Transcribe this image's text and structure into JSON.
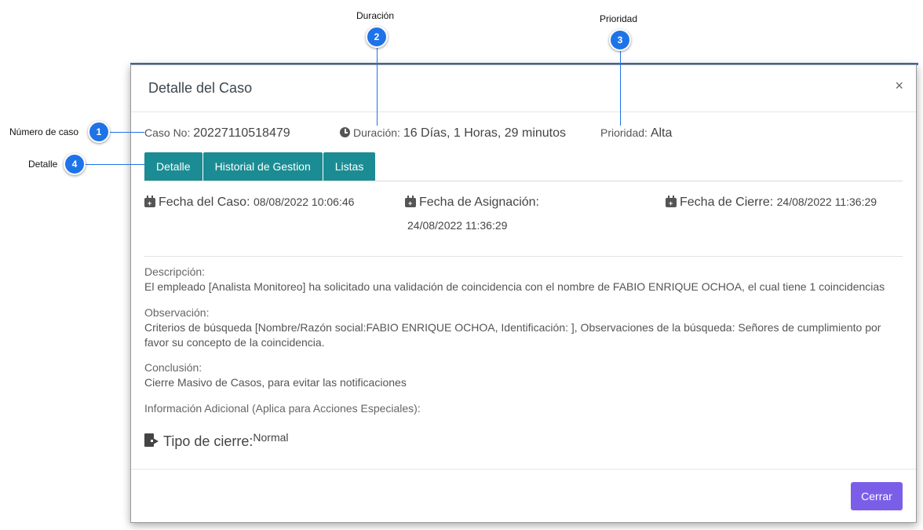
{
  "modal": {
    "title": "Detalle del Caso",
    "close": "×"
  },
  "case": {
    "number_label": "Caso No:",
    "number": "20227110518479",
    "duration_label": "Duración:",
    "duration": "16 Días, 1 Horas, 29 minutos",
    "priority_label": "Prioridad:",
    "priority": "Alta"
  },
  "tabs": [
    {
      "label": "Detalle"
    },
    {
      "label": "Historial de Gestion"
    },
    {
      "label": "Listas"
    }
  ],
  "dates": {
    "case_label": "Fecha del Caso:",
    "case_value": "08/08/2022 10:06:46",
    "assign_label": "Fecha de Asignación:",
    "assign_value": "24/08/2022 11:36:29",
    "close_label": "Fecha de Cierre:",
    "close_value": "24/08/2022 11:36:29"
  },
  "description": {
    "label": "Descripción:",
    "text": "El empleado [Analista Monitoreo] ha solicitado una validación de coincidencia con el nombre de FABIO ENRIQUE OCHOA, el cual tiene 1 coincidencias"
  },
  "observation": {
    "label": "Observación:",
    "text": "Criterios de búsqueda [Nombre/Razón social:FABIO ENRIQUE OCHOA, Identificación: ], Observaciones de la búsqueda: Señores de cumplimiento por favor su concepto de la coincidencia."
  },
  "conclusion": {
    "label": "Conclusión:",
    "text": "Cierre Masivo de Casos, para evitar las notificaciones"
  },
  "additional": {
    "label": "Información Adicional (Aplica para Acciones Especiales):"
  },
  "closure": {
    "label": "Tipo de cierre:",
    "value": "Normal"
  },
  "footer": {
    "close_button": "Cerrar"
  },
  "callouts": [
    {
      "number": "1",
      "label": "Número de caso"
    },
    {
      "number": "2",
      "label": "Duración"
    },
    {
      "number": "3",
      "label": "Prioridad"
    },
    {
      "number": "4",
      "label": "Detalle"
    }
  ],
  "colors": {
    "tab": "#1b8c93",
    "button": "#7b5ee8",
    "callout": "#1f73e8"
  }
}
